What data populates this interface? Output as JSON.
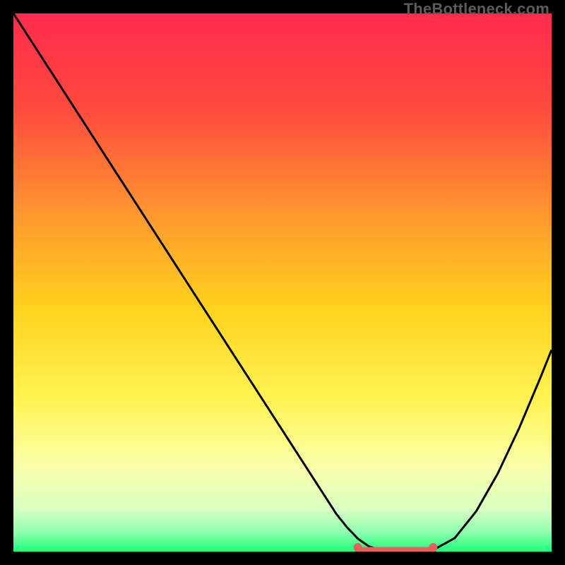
{
  "watermark": "TheBottleneck.com",
  "chart_data": {
    "type": "line",
    "title": "",
    "xlabel": "",
    "ylabel": "",
    "xlim": [
      0,
      100
    ],
    "ylim": [
      0,
      100
    ],
    "grid": false,
    "legend": false,
    "gradient_stops": [
      {
        "offset": 0.0,
        "color": "#ff2b4d"
      },
      {
        "offset": 0.18,
        "color": "#ff4b3e"
      },
      {
        "offset": 0.38,
        "color": "#ff9a2e"
      },
      {
        "offset": 0.55,
        "color": "#ffd21e"
      },
      {
        "offset": 0.72,
        "color": "#fff453"
      },
      {
        "offset": 0.84,
        "color": "#faffa8"
      },
      {
        "offset": 0.92,
        "color": "#d9ffc2"
      },
      {
        "offset": 0.965,
        "color": "#8dffb0"
      },
      {
        "offset": 1.0,
        "color": "#1aff77"
      }
    ],
    "series": [
      {
        "name": "bottleneck-curve",
        "x": [
          0.0,
          4,
          8,
          12,
          16,
          20,
          24,
          28,
          32,
          36,
          40,
          44,
          48,
          52,
          56,
          60,
          62,
          64,
          66,
          68,
          70,
          72,
          74,
          76,
          78,
          82,
          86,
          90,
          94,
          98,
          100
        ],
        "y": [
          100,
          93.8,
          87.6,
          81.4,
          75.2,
          69.0,
          62.8,
          56.6,
          50.4,
          44.2,
          38.0,
          31.8,
          25.6,
          19.4,
          13.2,
          7.0,
          4.5,
          2.4,
          1.0,
          0.3,
          0.0,
          0.0,
          0.0,
          0.0,
          0.3,
          2.5,
          7.5,
          14.5,
          23.0,
          32.5,
          37.5
        ]
      }
    ],
    "flat_region": {
      "x_start": 64,
      "x_end": 78,
      "color": "#e0635d",
      "endpoint_radius": 6
    }
  }
}
